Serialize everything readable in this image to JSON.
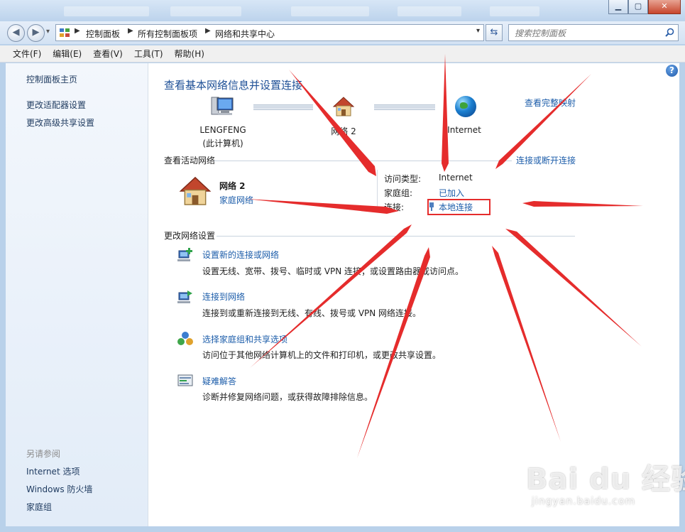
{
  "window": {
    "minimize": "▁",
    "maximize": "▢",
    "close": "✕"
  },
  "nav": {
    "back": "◀",
    "forward": "▶",
    "history": "▾",
    "breadcrumbs": [
      "控制面板",
      "所有控制面板项",
      "网络和共享中心"
    ],
    "refresh": "⇆",
    "search_placeholder": "搜索控制面板"
  },
  "menu": [
    "文件(F)",
    "编辑(E)",
    "查看(V)",
    "工具(T)",
    "帮助(H)"
  ],
  "sidebar": {
    "links": [
      "控制面板主页",
      "更改适配器设置",
      "更改高级共享设置"
    ],
    "see_also_title": "另请参阅",
    "see_also": [
      "Internet 选项",
      "Windows 防火墙",
      "家庭组"
    ]
  },
  "main": {
    "title": "查看基本网络信息并设置连接",
    "view_full_map": "查看完整映射",
    "map": {
      "computer_name": "LENGFENG",
      "computer_sub": "(此计算机)",
      "network_name": "网络  2",
      "internet": "Internet"
    },
    "active_header": "查看活动网络",
    "connect_disconnect": "连接或断开连接",
    "active_network": {
      "name": "网络  2",
      "type_link": "家庭网络",
      "access_type_label": "访问类型:",
      "access_type_value": "Internet",
      "homegroup_label": "家庭组:",
      "homegroup_value": "已加入",
      "connection_label": "连接:",
      "connection_value": "本地连接"
    },
    "change_header": "更改网络设置",
    "tasks": [
      {
        "title": "设置新的连接或网络",
        "desc": "设置无线、宽带、拨号、临时或 VPN 连接；或设置路由器或访问点。"
      },
      {
        "title": "连接到网络",
        "desc": "连接到或重新连接到无线、有线、拨号或 VPN 网络连接。"
      },
      {
        "title": "选择家庭组和共享选项",
        "desc": "访问位于其他网络计算机上的文件和打印机，或更改共享设置。"
      },
      {
        "title": "疑难解答",
        "desc": "诊断并修复网络问题，或获得故障排除信息。"
      }
    ],
    "help": "?"
  },
  "watermark": {
    "brand": "Bai du 经验",
    "url": "jingyan.baidu.com"
  },
  "colors": {
    "link": "#1c5daa",
    "annotation_red": "#e52c2c"
  }
}
